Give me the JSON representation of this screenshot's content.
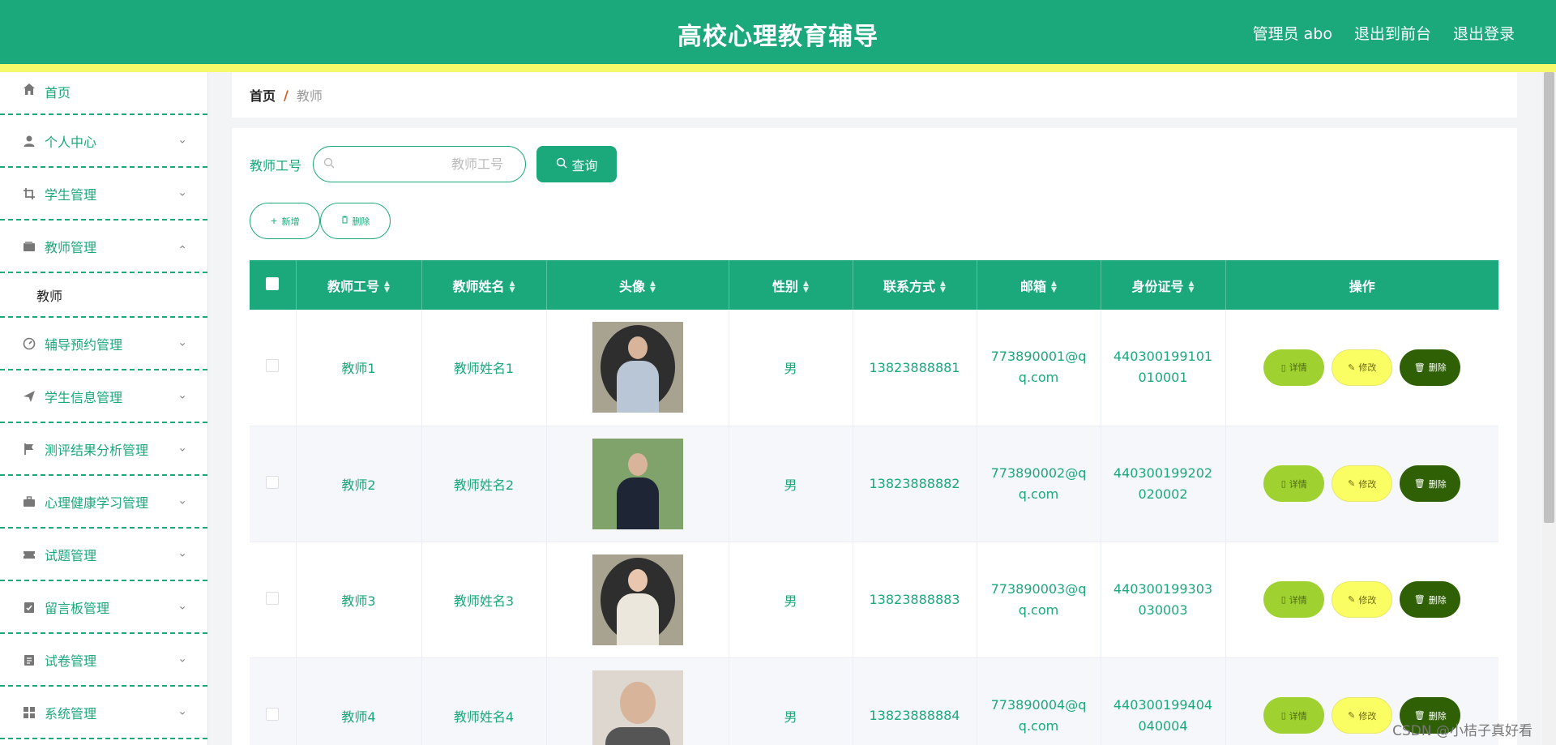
{
  "header": {
    "title": "高校心理教育辅导",
    "nav": [
      "管理员 abo",
      "退出到前台",
      "退出登录"
    ]
  },
  "sidebar": {
    "items": [
      {
        "label": "首页",
        "icon": "home-icon"
      },
      {
        "label": "个人中心",
        "icon": "user-icon"
      },
      {
        "label": "学生管理",
        "icon": "crop-icon"
      },
      {
        "label": "教师管理",
        "icon": "wallet-icon"
      },
      {
        "label": "辅导预约管理",
        "icon": "gauge-icon"
      },
      {
        "label": "学生信息管理",
        "icon": "send-icon"
      },
      {
        "label": "测评结果分析管理",
        "icon": "flag-icon"
      },
      {
        "label": "心理健康学习管理",
        "icon": "briefcase-icon"
      },
      {
        "label": "试题管理",
        "icon": "ticket-icon"
      },
      {
        "label": "留言板管理",
        "icon": "clipboard-check-icon"
      },
      {
        "label": "试卷管理",
        "icon": "document-icon"
      },
      {
        "label": "系统管理",
        "icon": "grid-icon"
      }
    ],
    "submenu": "教师"
  },
  "breadcrumb": {
    "home": "首页",
    "sep": "/",
    "current": "教师"
  },
  "search": {
    "label": "教师工号",
    "placeholder": "教师工号",
    "button": "查询"
  },
  "actions": {
    "add": "新增",
    "delete": "删除"
  },
  "table": {
    "headers": [
      "教师工号",
      "教师姓名",
      "头像",
      "性别",
      "联系方式",
      "邮箱",
      "身份证号",
      "操作"
    ],
    "rows": [
      {
        "id": "教师1",
        "name": "教师姓名1",
        "gender": "男",
        "phone": "13823888881",
        "email": "773890001@qq.com",
        "idcard": "440300199101010001"
      },
      {
        "id": "教师2",
        "name": "教师姓名2",
        "gender": "男",
        "phone": "13823888882",
        "email": "773890002@qq.com",
        "idcard": "440300199202020002"
      },
      {
        "id": "教师3",
        "name": "教师姓名3",
        "gender": "男",
        "phone": "13823888883",
        "email": "773890003@qq.com",
        "idcard": "440300199303030003"
      },
      {
        "id": "教师4",
        "name": "教师姓名4",
        "gender": "男",
        "phone": "13823888884",
        "email": "773890004@qq.com",
        "idcard": "440300199404040004"
      }
    ],
    "ops": {
      "detail": "详情",
      "edit": "修改",
      "delete": "删除"
    }
  },
  "watermark": "CSDN @小桔子真好看",
  "colors": {
    "primary": "#1ba87a",
    "stripe": "#f6f96a",
    "detail": "#9fd130",
    "edit": "#fbfe62",
    "delete": "#2f6006"
  }
}
